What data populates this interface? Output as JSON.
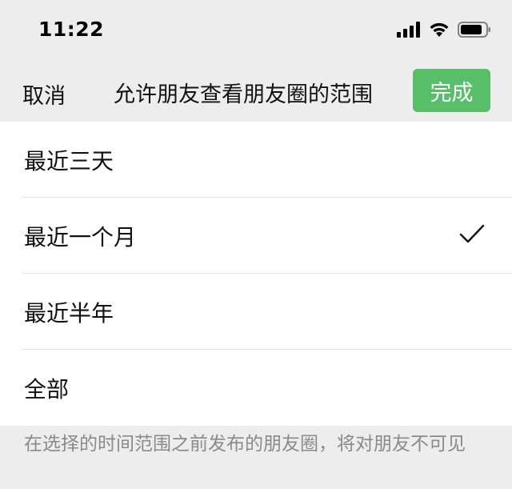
{
  "status_bar": {
    "time": "11:22",
    "icons": [
      "signal-bars-icon",
      "wifi-icon",
      "battery-icon"
    ]
  },
  "nav": {
    "cancel_label": "取消",
    "title": "允许朋友查看朋友圈的范围",
    "done_label": "完成"
  },
  "options": [
    {
      "label": "最近三天",
      "selected": false
    },
    {
      "label": "最近一个月",
      "selected": true
    },
    {
      "label": "最近半年",
      "selected": false
    },
    {
      "label": "全部",
      "selected": false
    }
  ],
  "footer_note": "在选择的时间范围之前发布的朋友圈，将对朋友不可见",
  "colors": {
    "accent": "#57be6a",
    "background": "#ededed",
    "list_background": "#ffffff",
    "note_text": "#8a8a8a"
  }
}
